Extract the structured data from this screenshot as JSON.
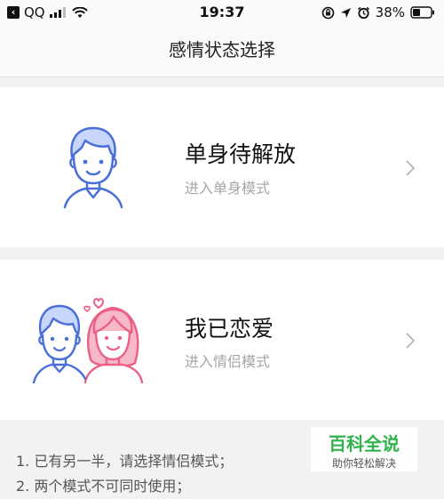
{
  "status_bar": {
    "carrier": "QQ",
    "time": "19:37",
    "battery": "38%"
  },
  "header": {
    "title": "感情状态选择"
  },
  "options": [
    {
      "title": "单身待解放",
      "subtitle": "进入单身模式",
      "icon": "single-person-avatar-icon"
    },
    {
      "title": "我已恋爱",
      "subtitle": "进入情侣模式",
      "icon": "couple-avatar-icon"
    }
  ],
  "notes": [
    "1. 已有另一半，请选择情侣模式；",
    "2. 两个模式不可同时使用；"
  ],
  "watermark": {
    "main": "百科全说",
    "sub": "助你轻松解决"
  },
  "colors": {
    "male_blue": "#4a6fd8",
    "male_hair": "#c8d6fb",
    "female_pink": "#ec5f86",
    "female_hair": "#f7b8ca",
    "watermark_green": "#2fb34a"
  }
}
